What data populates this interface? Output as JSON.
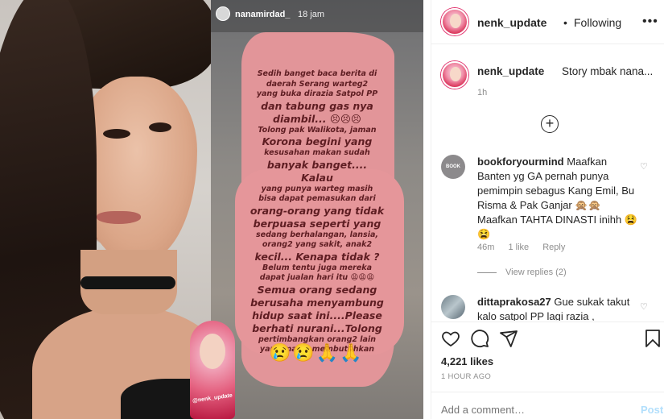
{
  "post": {
    "author": "nenk_update",
    "header_separator": "•",
    "follow_status": "Following",
    "caption_user": "nenk_update",
    "caption_text": "Story mbak nana...",
    "caption_time": "1h",
    "likes": "4,221 likes",
    "posted_ago": "1 HOUR AGO",
    "add_comment_placeholder": "Add a comment…",
    "post_label": "Post",
    "more_icon": "•••"
  },
  "story": {
    "username": "nanamirdad_",
    "time": "18 jam",
    "text_lines": [
      {
        "t": "Sedih banget baca berita di",
        "big": false
      },
      {
        "t": "daerah Serang warteg2",
        "big": false
      },
      {
        "t": "yang buka dirazia Satpol PP",
        "big": false
      },
      {
        "t": "dan tabung gas nya",
        "big": true
      },
      {
        "t": "diambil... 😣😣😣",
        "big": true
      },
      {
        "t": "Tolong pak Walikota, jaman",
        "big": false
      },
      {
        "t": "Korona begini yang",
        "big": true
      },
      {
        "t": "kesusahan makan sudah",
        "big": false
      },
      {
        "t": "banyak banget.... Kalau",
        "big": true
      },
      {
        "t": "yang punya warteg masih",
        "big": false
      },
      {
        "t": "bisa dapat pemasukan dari",
        "big": false
      },
      {
        "t": "orang-orang yang tidak",
        "big": true
      },
      {
        "t": "berpuasa seperti yang",
        "big": true
      },
      {
        "t": "sedang berhalangan, lansia,",
        "big": false
      },
      {
        "t": "orang2 yang sakit, anak2",
        "big": false
      },
      {
        "t": "kecil... Kenapa tidak ?",
        "big": true
      },
      {
        "t": "Belum tentu juga mereka",
        "big": false
      },
      {
        "t": "dapat jualan hari itu 😩😩😩",
        "big": false
      },
      {
        "t": "Semua orang sedang",
        "big": true
      },
      {
        "t": "berusaha menyambung",
        "big": true
      },
      {
        "t": "hidup saat ini....Please",
        "big": true
      },
      {
        "t": "berhati nurani...Tolong",
        "big": true
      },
      {
        "t": "pertimbangkan orang2 lain",
        "big": false
      },
      {
        "t": "yang masih membutuhkan",
        "big": false
      }
    ],
    "emoji_row": "😢😢🙏🙏",
    "sticker_text": "@nenk_update"
  },
  "comments": [
    {
      "user": "bookforyourmind",
      "avatar_text": "BOOK",
      "text": "Maafkan Banten yg GA pernah punya pemimpin sebagus Kang Emil, Bu Risma & Pak Ganjar 🙊🙊 Maafkan TAHTA DINASTI inihh 😫😫",
      "time": "46m",
      "likes": "1 like",
      "reply": "Reply",
      "view_replies": "View replies (2)"
    },
    {
      "user": "dittaprakosa27",
      "text": "Gue sukak takut kalo satpol PP lagi razia ,"
    }
  ],
  "icons": {
    "heart": "heart-icon",
    "comment": "comment-icon",
    "share": "share-icon",
    "save": "bookmark-icon",
    "add": "plus-circle-icon"
  },
  "colors": {
    "accent_link": "#b2dffc",
    "muted": "#8e8e8e",
    "text": "#262626",
    "story_pink": "#e5969a",
    "avatar_ring": "#e1306c"
  }
}
